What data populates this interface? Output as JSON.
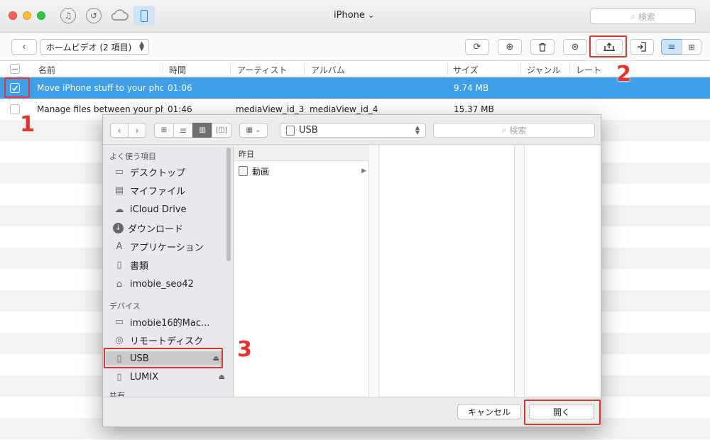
{
  "window": {
    "title": "iPhone",
    "title_chevron": "⌄",
    "search_placeholder": "検索"
  },
  "toolbar": {
    "category_select": "ホームビデオ (2 項目)",
    "buttons": [
      "refresh-icon",
      "add-icon",
      "delete-icon",
      "to-itunes-icon",
      "export-to-computer-icon",
      "import-icon",
      "list-view-icon",
      "grid-view-icon"
    ]
  },
  "table": {
    "columns": [
      "名前",
      "時間",
      "アーティスト",
      "アルバム",
      "サイズ",
      "ジャンル",
      "レート"
    ],
    "rows": [
      {
        "name": "Move iPhone stuff to your pho...",
        "time": "01:06",
        "artist": "",
        "album": "",
        "size": "9.74 MB",
        "selected": true
      },
      {
        "name": "Manage files between your ph...",
        "time": "01:46",
        "artist": "mediaView_id_3",
        "album": "mediaView_id_4",
        "size": "15.37 MB",
        "selected": false
      }
    ]
  },
  "callouts": [
    "1",
    "2",
    "3"
  ],
  "dialog": {
    "location": "USB",
    "search_placeholder": "検索",
    "sidebar": {
      "favorites_header": "よく使う項目",
      "favorites": [
        "デスクトップ",
        "マイファイル",
        "iCloud Drive",
        "ダウンロード",
        "アプリケーション",
        "書類",
        "imobie_seo42"
      ],
      "devices_header": "デバイス",
      "devices": [
        "imobie16的Mac...",
        "リモートディスク",
        "USB",
        "LUMIX"
      ],
      "shared_header": "共有"
    },
    "column_header": "昨日",
    "file": "動画",
    "cancel_label": "キャンセル",
    "open_label": "開く"
  },
  "colors": {
    "selection": "#3e9ee8",
    "callout": "#e8322b",
    "sidebar_selected": "#cacaca"
  }
}
